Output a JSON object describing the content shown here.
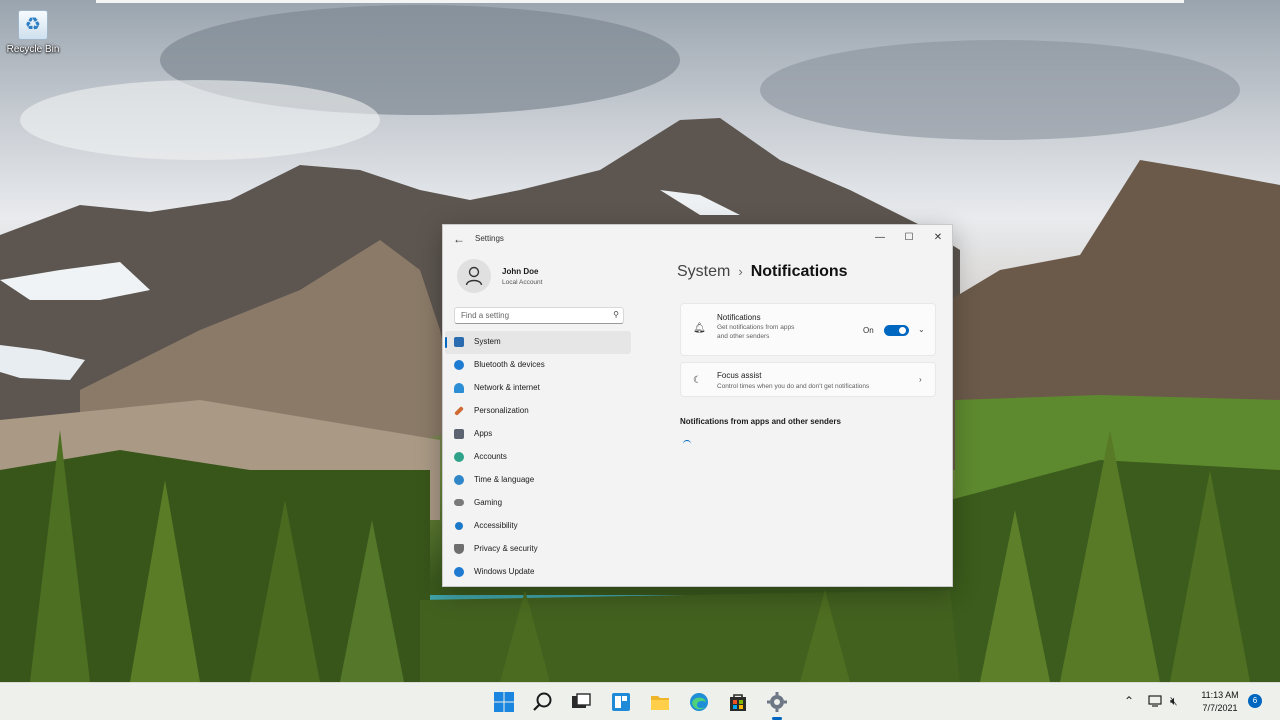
{
  "desktop": {
    "icons": [
      {
        "label": "Recycle Bin",
        "icon": "recycle-bin-icon"
      }
    ]
  },
  "window": {
    "title": "Settings",
    "back_icon": "back-arrow-icon",
    "controls": {
      "minimize": "minimize-icon",
      "maximize": "maximize-icon",
      "close": "close-icon"
    }
  },
  "profile": {
    "name": "John Doe",
    "account_type": "Local Account"
  },
  "search": {
    "placeholder": "Find a setting"
  },
  "sidebar": {
    "items": [
      {
        "label": "System",
        "icon": "system-icon",
        "color": "#2b6cb0",
        "active": true
      },
      {
        "label": "Bluetooth & devices",
        "icon": "bluetooth-icon",
        "color": "#1f7ad1"
      },
      {
        "label": "Network & internet",
        "icon": "network-icon",
        "color": "#2c8fd6"
      },
      {
        "label": "Personalization",
        "icon": "brush-icon",
        "color": "#d06a33"
      },
      {
        "label": "Apps",
        "icon": "apps-icon",
        "color": "#5b6470"
      },
      {
        "label": "Accounts",
        "icon": "accounts-icon",
        "color": "#2ea38a"
      },
      {
        "label": "Time & language",
        "icon": "globe-clock-icon",
        "color": "#2f86c8"
      },
      {
        "label": "Gaming",
        "icon": "gamepad-icon",
        "color": "#7a7a7a"
      },
      {
        "label": "Accessibility",
        "icon": "accessibility-icon",
        "color": "#1e78c8"
      },
      {
        "label": "Privacy & security",
        "icon": "shield-icon",
        "color": "#6e6e6e"
      },
      {
        "label": "Windows Update",
        "icon": "update-icon",
        "color": "#1f7ad1"
      }
    ]
  },
  "main": {
    "breadcrumb": {
      "parent": "System",
      "separator": "›",
      "current": "Notifications"
    },
    "notifications_card": {
      "icon": "bell-icon",
      "title": "Notifications",
      "description": "Get notifications from apps and other senders",
      "toggle_label": "On",
      "toggle_on": true,
      "expand_icon": "chevron-down-icon"
    },
    "focus_card": {
      "icon": "moon-icon",
      "title": "Focus assist",
      "description": "Control times when you do and don't get notifications",
      "nav_icon": "chevron-right-icon"
    },
    "section_title": "Notifications from apps and other senders"
  },
  "taskbar": {
    "apps": [
      "start-icon",
      "search-icon",
      "task-view-icon",
      "widgets-icon",
      "file-explorer-icon",
      "edge-icon",
      "store-icon",
      "settings-icon"
    ],
    "tray": {
      "chevron": "show-hidden-icons-icon",
      "network": "network-icon",
      "volume": "volume-muted-icon"
    },
    "clock": {
      "time": "11:13 AM",
      "date": "7/7/2021"
    },
    "notification_count": "6"
  }
}
